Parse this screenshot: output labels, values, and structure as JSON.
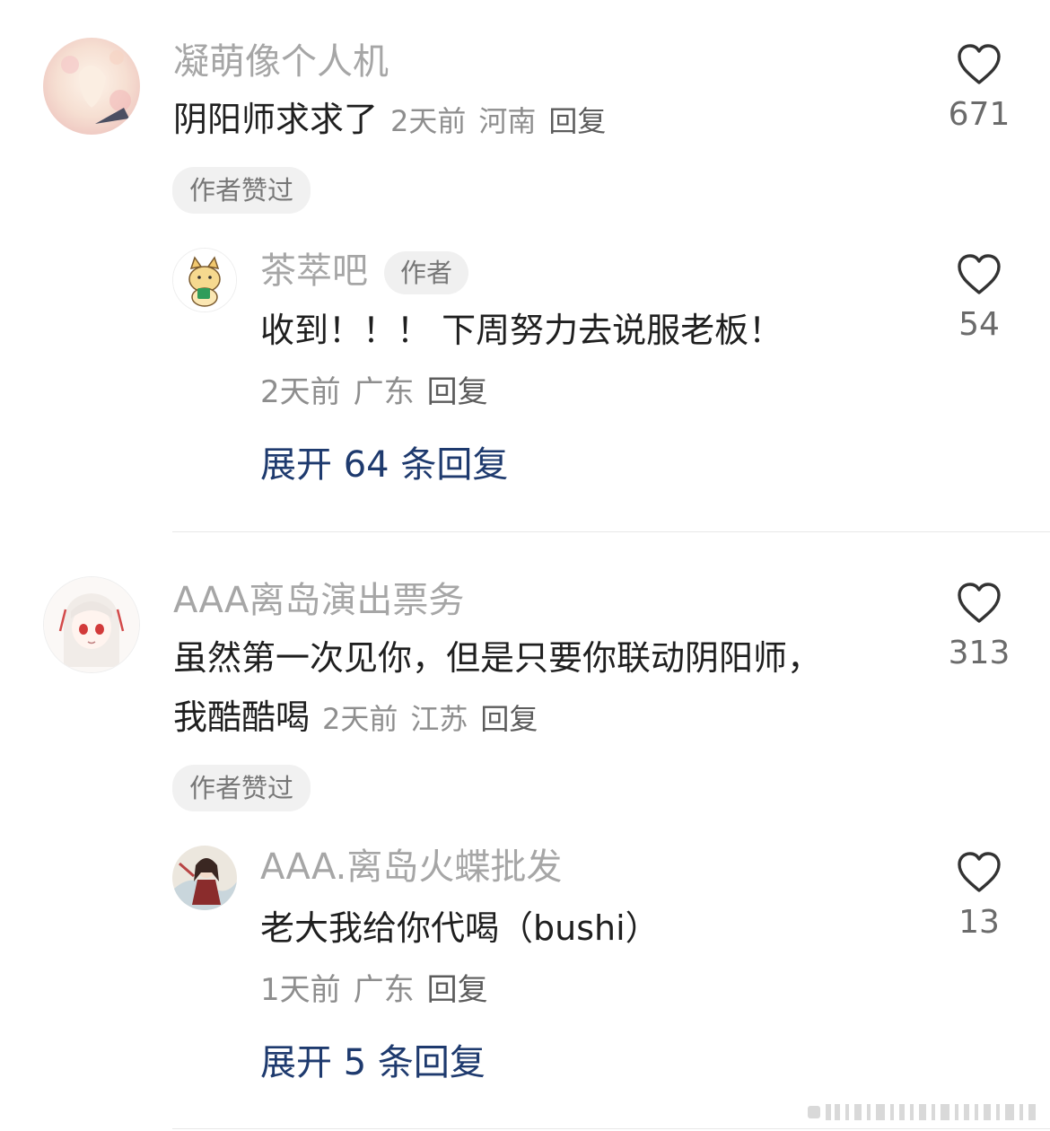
{
  "comments": [
    {
      "username": "凝萌像个人机",
      "text": "阴阳师求求了",
      "time": "2天前",
      "location": "河南",
      "reply_label": "回复",
      "likes": "671",
      "author_liked_label": "作者赞过",
      "reply": {
        "username": "茶萃吧",
        "badge": "作者",
        "text": "收到！！！ 下周努力去说服老板！",
        "time": "2天前",
        "location": "广东",
        "reply_label": "回复",
        "likes": "54"
      },
      "expand_label": "展开 64 条回复"
    },
    {
      "username": "AAA离岛演出票务",
      "text_line1": "虽然第一次见你，但是只要你联动阴阳师，",
      "text_line2": "我酷酷喝",
      "time": "2天前",
      "location": "江苏",
      "reply_label": "回复",
      "likes": "313",
      "author_liked_label": "作者赞过",
      "reply": {
        "username": "AAA.离岛火蝶批发",
        "text": "老大我给你代喝（bushi）",
        "time": "1天前",
        "location": "广东",
        "reply_label": "回复",
        "likes": "13"
      },
      "expand_label": "展开 5 条回复"
    }
  ],
  "colors": {
    "username": "#a6a6a6",
    "expand_link": "#1e3a6e",
    "chip_bg": "#f1f1f1"
  }
}
